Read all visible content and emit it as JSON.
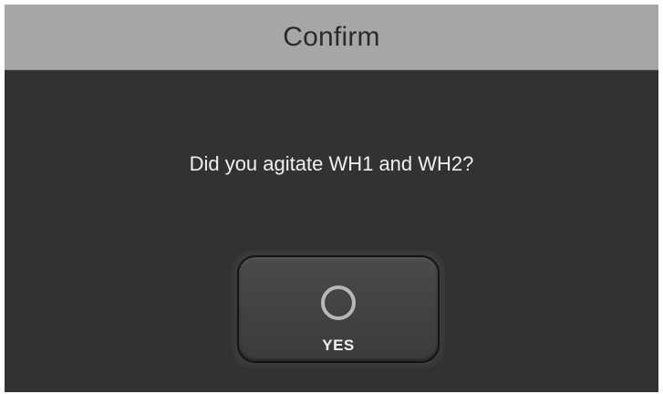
{
  "dialog": {
    "title": "Confirm",
    "message": "Did you agitate WH1 and WH2?",
    "confirm_button": {
      "label": "YES",
      "icon": "circle-icon"
    }
  },
  "colors": {
    "titlebar_bg": "#a6a6a6",
    "dialog_bg": "#323232",
    "text": "#f0f0f0",
    "icon_stroke": "#b8b8b8"
  }
}
